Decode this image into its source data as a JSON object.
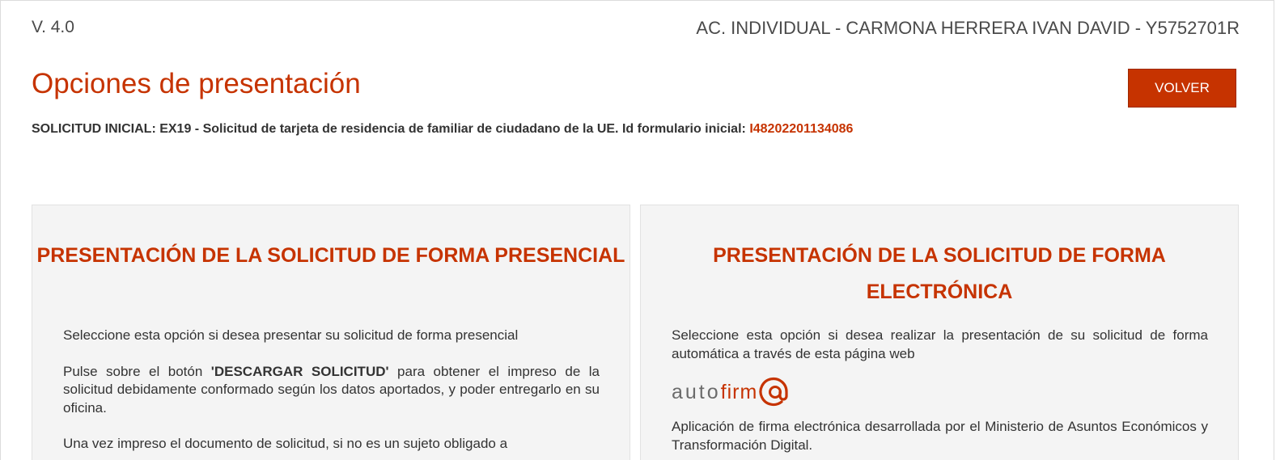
{
  "header": {
    "version": "V. 4.0",
    "user_info": "AC. INDIVIDUAL - CARMONA HERRERA IVAN DAVID - Y5752701R"
  },
  "page": {
    "title": "Opciones de presentación",
    "back_label": "VOLVER",
    "subtitle_prefix": "SOLICITUD INICIAL: EX19 - Solicitud de tarjeta de residencia de familiar de ciudadano de la UE. Id formulario inicial:",
    "form_id": "I48202201134086"
  },
  "cards": {
    "in_person": {
      "title": "PRESENTACIÓN DE LA SOLICITUD DE FORMA PRESENCIAL",
      "p1": "Seleccione esta opción si desea presentar su solicitud de forma presencial",
      "p2_before": "Pulse sobre el botón ",
      "p2_bold": "'DESCARGAR SOLICITUD'",
      "p2_after": " para obtener el impreso de la solicitud debidamente conformado según los datos aportados, y poder entregarlo en su oficina.",
      "p3": "Una vez impreso el documento de solicitud, si no es un sujeto obligado a"
    },
    "electronic": {
      "title": "PRESENTACIÓN DE LA SOLICITUD DE FORMA ELECTRÓNICA",
      "p1": "Seleccione esta opción si desea realizar la presentación de su solicitud de forma automática a través de esta página web",
      "logo_part1": "auto",
      "logo_part2": "firm",
      "logo_icon": "at-sign-icon",
      "p2": "Aplicación de firma electrónica desarrollada por el Ministerio de Asuntos Económicos y Transformación Digital."
    }
  },
  "colors": {
    "accent": "#c63300",
    "text": "#333333",
    "card_bg": "#f4f4f4"
  }
}
